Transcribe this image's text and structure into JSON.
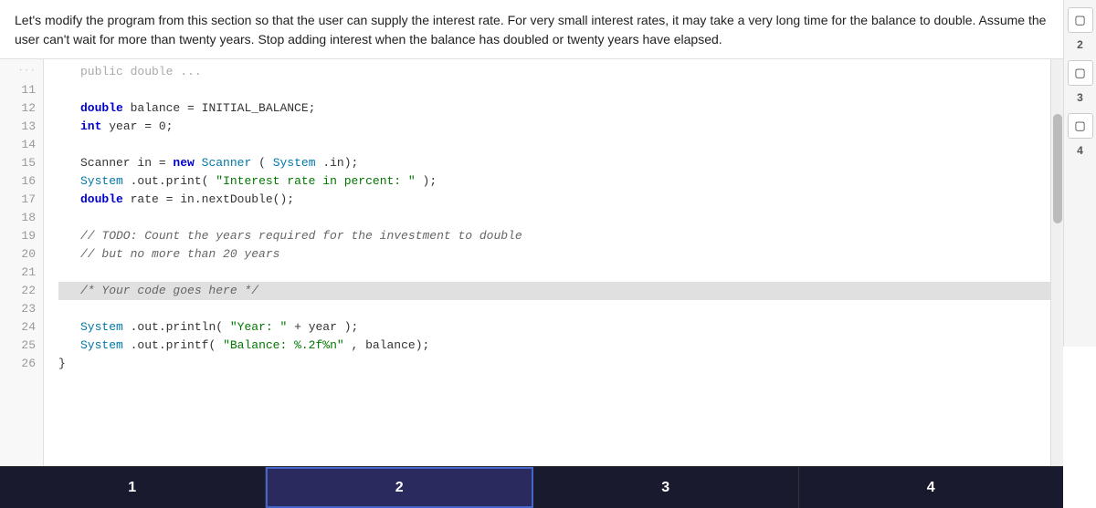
{
  "description": {
    "text": "Let's modify the program from this section so that the user can supply the interest rate. For very small interest rates, it may take a very long time for the balance to double. Assume the user can't wait for more than twenty years. Stop adding interest when the balance has doubled or twenty years have elapsed."
  },
  "code": {
    "lines": [
      {
        "num": 11,
        "content": "",
        "type": "empty"
      },
      {
        "num": 12,
        "content": "double balance = INITIAL_BALANCE;",
        "type": "code"
      },
      {
        "num": 13,
        "content": "int year = 0;",
        "type": "code"
      },
      {
        "num": 14,
        "content": "",
        "type": "empty"
      },
      {
        "num": 15,
        "content": "Scanner in = new Scanner(System.in);",
        "type": "code"
      },
      {
        "num": 16,
        "content": "System.out.print(\"Interest rate in percent: \");",
        "type": "code"
      },
      {
        "num": 17,
        "content": "double rate = in.nextDouble();",
        "type": "code"
      },
      {
        "num": 18,
        "content": "",
        "type": "empty"
      },
      {
        "num": 19,
        "content": "// TODO: Count the years required for the investment to double",
        "type": "comment"
      },
      {
        "num": 20,
        "content": "// but no more than 20 years",
        "type": "comment"
      },
      {
        "num": 21,
        "content": "",
        "type": "empty"
      },
      {
        "num": 22,
        "content": "/* Your code goes here */",
        "type": "block-comment",
        "highlighted": true
      },
      {
        "num": 23,
        "content": "",
        "type": "empty"
      },
      {
        "num": 24,
        "content": "System.out.println(\"Year: \" + year);",
        "type": "code"
      },
      {
        "num": 25,
        "content": "System.out.printf(\"Balance: %.2f%n\", balance);",
        "type": "code"
      },
      {
        "num": 26,
        "content": "}",
        "type": "code"
      }
    ]
  },
  "tabs": [
    {
      "label": "1",
      "active": true,
      "selected": false
    },
    {
      "label": "2",
      "active": false,
      "selected": true
    },
    {
      "label": "3",
      "active": false,
      "selected": false
    },
    {
      "label": "4",
      "active": false,
      "selected": false
    }
  ],
  "sidebar": {
    "items": [
      {
        "label": "2"
      },
      {
        "label": "3"
      },
      {
        "label": "4"
      }
    ]
  }
}
